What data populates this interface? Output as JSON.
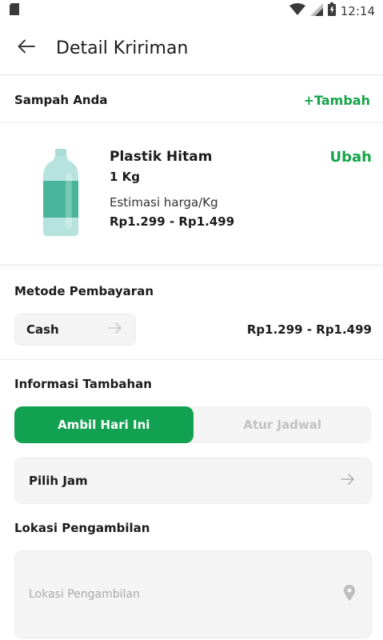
{
  "status_bar": {
    "time": "12:14",
    "icons": [
      "sd-card-icon",
      "wifi-icon",
      "signal-icon",
      "battery-icon"
    ]
  },
  "header": {
    "title": "Detail Kririman",
    "back_icon": "arrow-left-icon"
  },
  "waste": {
    "section_title": "Sampah Anda",
    "add_label": "+Tambah",
    "item": {
      "name": "Plastik Hitam",
      "quantity": "1 Kg",
      "estimate_label": "Estimasi harga/Kg",
      "estimate_value": "Rp1.299 - Rp1.499",
      "edit_label": "Ubah",
      "image_icon": "plastic-bottle-icon"
    }
  },
  "payment": {
    "section_title": "Metode Pembayaran",
    "method_label": "Cash",
    "amount": "Rp1.299 - Rp1.499"
  },
  "additional": {
    "section_title": "Informasi Tambahan",
    "toggle": {
      "active_label": "Ambil Hari Ini",
      "inactive_label": "Atur Jadwal"
    },
    "time_field_label": "Pilih Jam"
  },
  "pickup": {
    "section_title": "Lokasi Pengambilan",
    "placeholder": "Lokasi Pengambilan",
    "location_icon": "location-pin-icon"
  },
  "colors": {
    "accent": "#16a34a",
    "accent_fill": "#12a150",
    "field_bg": "#f4f4f4"
  }
}
